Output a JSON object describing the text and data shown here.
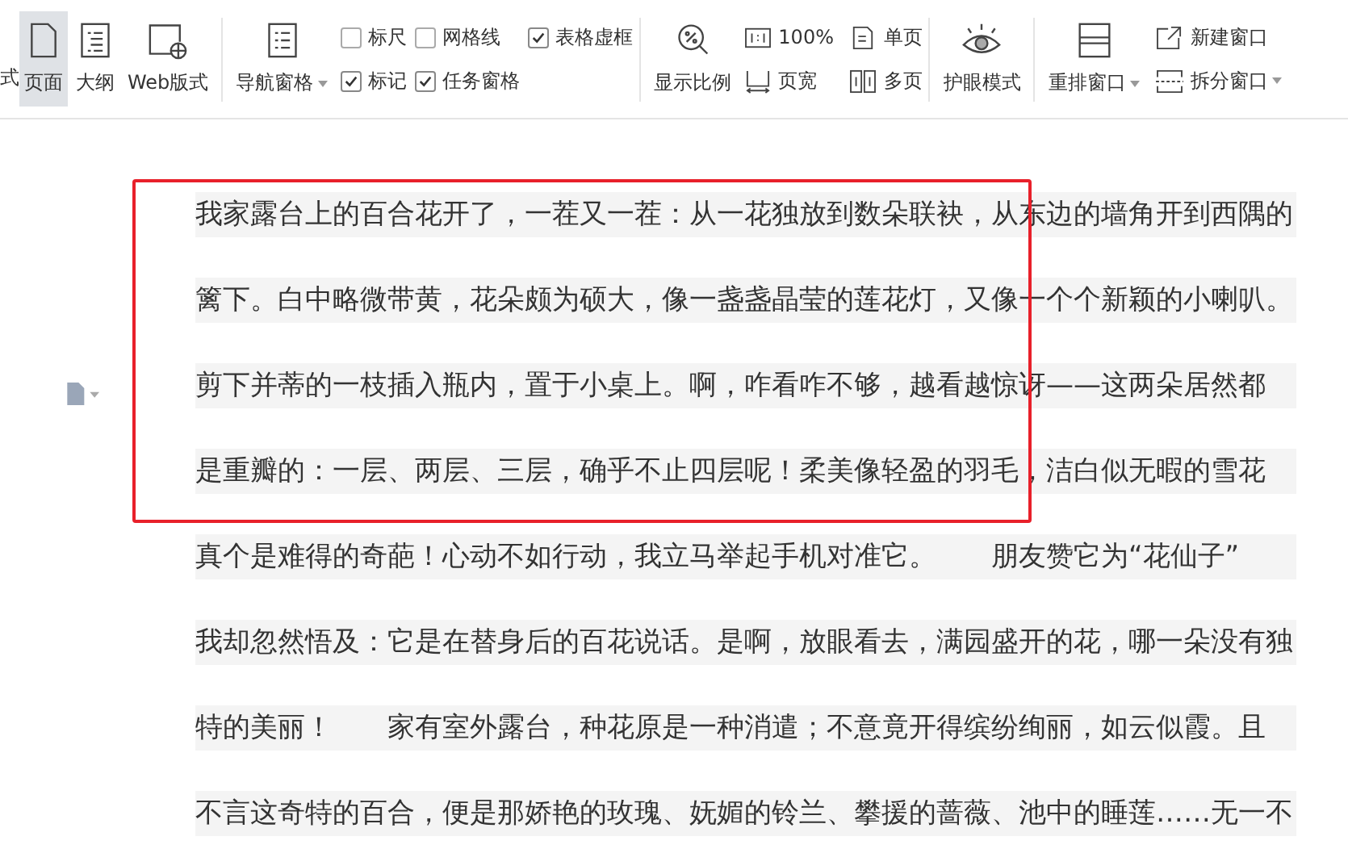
{
  "toolbar": {
    "cut_label": "式",
    "views": [
      {
        "label": "页面",
        "kind": "page",
        "selected": true
      },
      {
        "label": "大纲",
        "kind": "outline",
        "selected": false
      },
      {
        "label": "Web版式",
        "kind": "web",
        "selected": false
      }
    ],
    "nav_pane": {
      "label": "导航窗格"
    },
    "checkboxes": [
      {
        "label": "标尺",
        "checked": false
      },
      {
        "label": "网格线",
        "checked": false
      },
      {
        "label": "表格虚框",
        "checked": true
      },
      {
        "label": "标记",
        "checked": true
      },
      {
        "label": "任务窗格",
        "checked": true
      }
    ],
    "zoom": {
      "label": "显示比例"
    },
    "zoom_buttons": [
      {
        "label": "100%",
        "kind": "ratio"
      },
      {
        "label": "页宽",
        "kind": "width"
      },
      {
        "label": "单页",
        "kind": "single"
      },
      {
        "label": "多页",
        "kind": "multi"
      }
    ],
    "eye_mode": {
      "label": "护眼模式"
    },
    "arrange": {
      "label": "重排窗口"
    },
    "window_buttons": [
      {
        "label": "新建窗口",
        "kind": "new",
        "dropdown": false
      },
      {
        "label": "拆分窗口",
        "kind": "split",
        "dropdown": true
      }
    ]
  },
  "document": {
    "lines": [
      "我家露台上的百合花开了，一茬又一茬：从一花独放到数朵联袂，从东边的墙角开到西隅的",
      "篱下。白中略微带黄，花朵颇为硕大，像一盏盏晶莹的莲花灯，又像一个个新颖的小喇叭。",
      "剪下并蒂的一枝插入瓶内，置于小桌上。啊，咋看咋不够，越看越惊讶——这两朵居然都",
      "是重瓣的：一层、两层、三层，确乎不止四层呢！柔美像轻盈的羽毛，洁白似无暇的雪花",
      "真个是难得的奇葩！心动不如行动，我立马举起手机对准它。　　朋友赞它为“花仙子”",
      "我却忽然悟及：它是在替身后的百花说话。是啊，放眼看去，满园盛开的花，哪一朵没有独",
      "特的美丽！　　家有室外露台，种花原是一种消遣；不意竟开得缤纷绚丽，如云似霞。且",
      "不言这奇特的百合，便是那娇艳的玫瑰、妩媚的铃兰、攀援的蔷薇、池中的睡莲……无一不"
    ]
  }
}
